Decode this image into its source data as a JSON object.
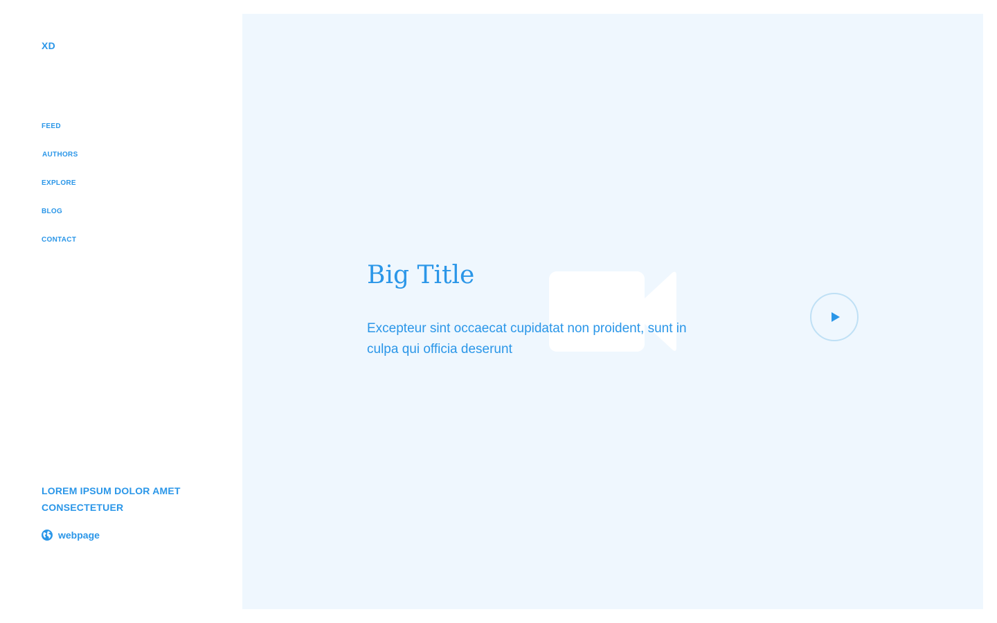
{
  "sidebar": {
    "logo": "XD",
    "nav": [
      {
        "label": "FEED"
      },
      {
        "label": "AUTHORS"
      },
      {
        "label": "EXPLORE"
      },
      {
        "label": "BLOG"
      },
      {
        "label": "CONTACT"
      }
    ],
    "tagline_line1": "LOREM IPSUM DOLOR AMET",
    "tagline_line2": "CONSECTETUER",
    "webpage": {
      "label": "webpage",
      "icon": "globe-icon"
    }
  },
  "hero": {
    "title": "Big Title",
    "text": "Excepteur sint occaecat cupidatat non proident, sunt in culpa qui officia deserunt",
    "background_icon": "video-camera-icon",
    "play_icon": "play-icon"
  },
  "colors": {
    "accent": "#2a96e8",
    "hero_background": "#eff7fe",
    "play_ring": "#bfe0f5",
    "page_background": "#ffffff"
  }
}
